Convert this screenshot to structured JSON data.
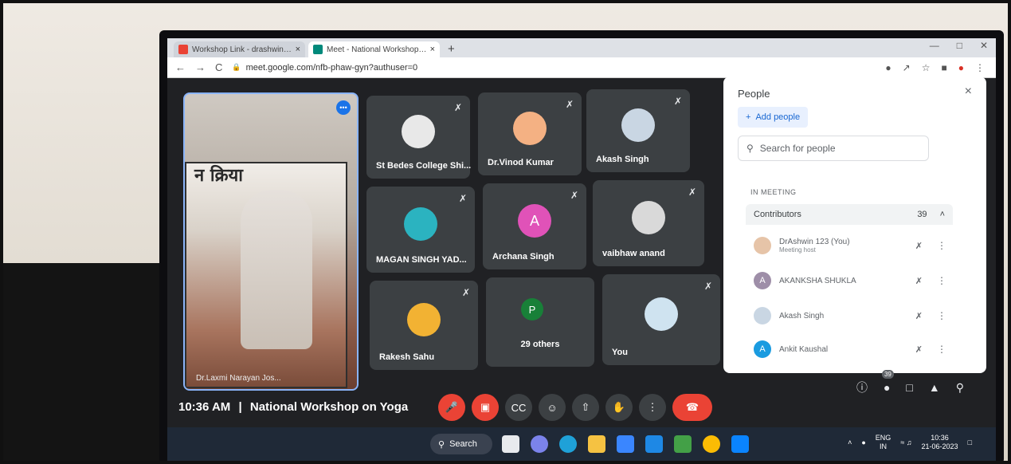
{
  "browser": {
    "tabs": [
      {
        "label": "Workshop Link - drashwin263@...",
        "close": "×"
      },
      {
        "label": "Meet - National Workshop o...",
        "close": "×"
      }
    ],
    "new_tab": "+",
    "nav": {
      "back": "←",
      "forward": "→",
      "reload": "C"
    },
    "url": "meet.google.com/nfb-phaw-gyn?authuser=0"
  },
  "pinned": {
    "hindi_text": "न क्रिया",
    "name": "Dr.Laxmi Narayan Jos..."
  },
  "tiles": [
    {
      "name": "St Bedes College Shi..."
    },
    {
      "name": "Dr.Vinod Kumar"
    },
    {
      "name": "Akash Singh"
    },
    {
      "name": "MAGAN SINGH YAD..."
    },
    {
      "name": "Archana Singh",
      "initial": "A"
    },
    {
      "name": "vaibhaw anand"
    },
    {
      "name": "Rakesh Sahu"
    },
    {
      "name": "29 others",
      "initial": "P"
    },
    {
      "name": "You"
    }
  ],
  "people": {
    "title": "People",
    "close": "×",
    "add_label": "Add people",
    "search_placeholder": "Search for people",
    "in_meeting": "IN MEETING",
    "contributors_label": "Contributors",
    "contributors_count": "39",
    "list": [
      {
        "name": "DrAshwin 123 (You)",
        "sub": "Meeting host",
        "initial": ""
      },
      {
        "name": "AKANKSHA SHUKLA",
        "sub": "",
        "initial": "A"
      },
      {
        "name": "Akash Singh",
        "sub": "",
        "initial": ""
      },
      {
        "name": "Ankit Kaushal",
        "sub": "",
        "initial": "A"
      }
    ]
  },
  "bottom": {
    "time": "10:36 AM",
    "separator": "|",
    "meeting_title": "National Workshop on Yoga",
    "people_badge": "39"
  },
  "taskbar": {
    "search_label": "Search",
    "lang_top": "ENG",
    "lang_bottom": "IN",
    "time": "10:36",
    "date": "21-06-2023"
  }
}
